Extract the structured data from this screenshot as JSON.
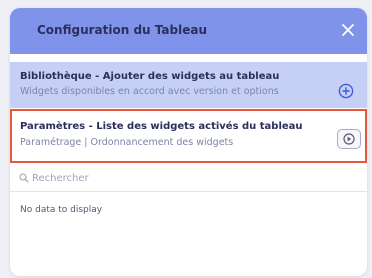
{
  "dialog": {
    "title": "Configuration du Tableau"
  },
  "library": {
    "title": "Bibliothèque - Ajouter des widgets au tableau",
    "subtitle": "Widgets disponibles en accord avec version et options"
  },
  "parameters": {
    "title": "Paramètres - Liste des widgets activés du tableau",
    "subtitle": "Paramétrage | Ordonnancement des widgets"
  },
  "search": {
    "placeholder": "Rechercher",
    "value": ""
  },
  "list": {
    "empty_text": "No data to display"
  },
  "colors": {
    "header": "#7f93ea",
    "library_row": "#c6d0f7",
    "highlight_border": "#e7563f",
    "accent_blue": "#3f5bd8"
  },
  "icons": {
    "close": "close-icon",
    "add": "plus-circle-icon",
    "play": "play-circle-icon",
    "search": "search-icon"
  }
}
